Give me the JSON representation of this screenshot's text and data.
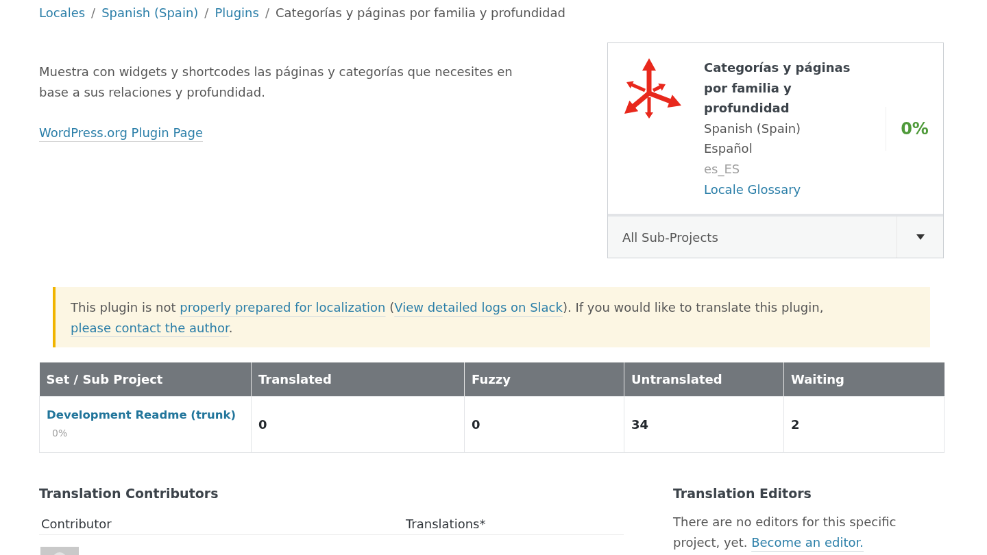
{
  "breadcrumbs": [
    {
      "kind": "link",
      "label": "Locales"
    },
    {
      "kind": "separator",
      "label": "/"
    },
    {
      "kind": "link",
      "label": "Spanish (Spain)"
    },
    {
      "kind": "separator",
      "label": "/"
    },
    {
      "kind": "link",
      "label": "Plugins"
    },
    {
      "kind": "separator",
      "label": "/"
    },
    {
      "kind": "current",
      "label": "Categorías y páginas por familia y profundidad"
    }
  ],
  "plugin": {
    "description": "Muestra con widgets y shortcodes las páginas y categorías que necesites en base a sus relaciones y profundidad.",
    "plugin_page_link": "WordPress.org Plugin Page"
  },
  "project_card": {
    "title": "Categorías y páginas por familia y profundidad",
    "locale_name": "Spanish (Spain)",
    "native_name": "Español",
    "locale_code": "es_ES",
    "glossary_link": "Locale Glossary",
    "percent": "0%",
    "subproject_select": {
      "value": "All Sub-Projects"
    }
  },
  "notice": {
    "segments": [
      {
        "kind": "text",
        "text": "This plugin is not "
      },
      {
        "kind": "link",
        "text": "properly prepared for localization"
      },
      {
        "kind": "text",
        "text": " ("
      },
      {
        "kind": "link",
        "text": "View detailed logs on Slack"
      },
      {
        "kind": "text",
        "text": "). If you would like to translate this plugin, "
      },
      {
        "kind": "link",
        "text": "please contact the author"
      },
      {
        "kind": "text",
        "text": "."
      }
    ]
  },
  "table": {
    "columns": [
      "Set / Sub Project",
      "Translated",
      "Fuzzy",
      "Untranslated",
      "Waiting"
    ],
    "rows": [
      {
        "cells": [
          {
            "kind": "project",
            "text": "Development Readme (trunk)",
            "percent": "0%"
          },
          {
            "kind": "count",
            "text": "0"
          },
          {
            "kind": "count",
            "text": "0"
          },
          {
            "kind": "count",
            "text": "34"
          },
          {
            "kind": "count",
            "text": "2"
          }
        ]
      }
    ]
  },
  "contributors": {
    "title": "Translation Contributors",
    "columns": [
      "Contributor",
      "Translations*"
    ],
    "rows": [
      {
        "avatar": true
      }
    ]
  },
  "editors": {
    "title": "Translation Editors",
    "segments": [
      {
        "kind": "text",
        "text": "There are no editors for this specific project, yet. "
      },
      {
        "kind": "link",
        "text": "Become an editor."
      }
    ]
  }
}
